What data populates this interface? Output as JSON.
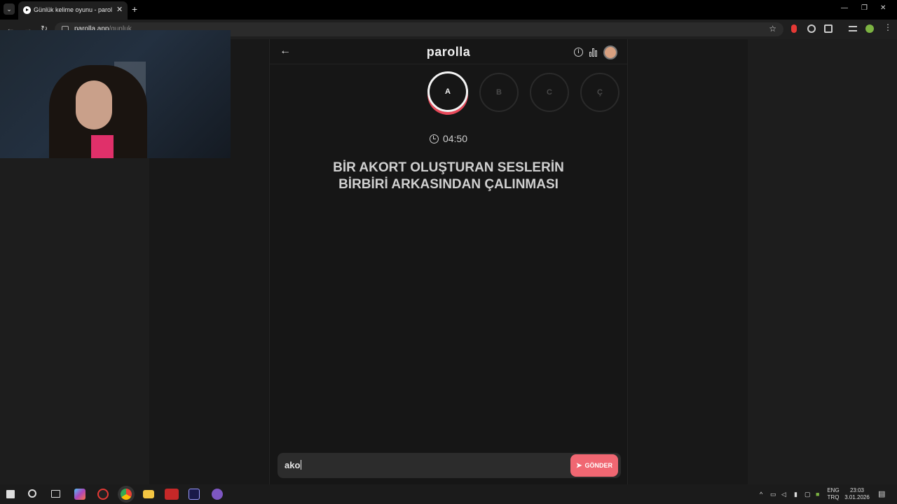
{
  "browser": {
    "tab_title": "Günlük kelime oyunu - parolla",
    "url_host": "parolla.app",
    "url_path": "/gunluk"
  },
  "app": {
    "logo": "parolla",
    "letters": [
      {
        "label": "A",
        "state": "active"
      },
      {
        "label": "B",
        "state": "pending"
      },
      {
        "label": "C",
        "state": "pending"
      },
      {
        "label": "Ç",
        "state": "pending"
      }
    ],
    "timer": "04:50",
    "question_line1": "BİR AKORT OLUŞTURAN SESLERİN",
    "question_line2": "BİRBİRİ ARKASINDAN ÇALINMASI",
    "answer_value": "ako",
    "send_label": "GÖNDER"
  },
  "taskbar": {
    "lang_top": "ENG",
    "lang_bottom": "TRQ",
    "time": "23:03",
    "date": "3.01.2026"
  },
  "colors": {
    "accent": "#f06772",
    "active_ring_shadow": "#e8495a",
    "background": "#161616"
  }
}
